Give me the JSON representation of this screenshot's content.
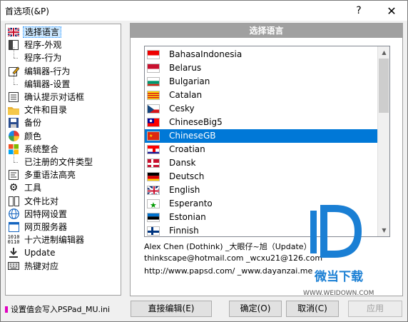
{
  "window": {
    "title": "首选项(&P)",
    "help_label": "?",
    "close_label": "✕"
  },
  "tree": [
    {
      "label": "选择语言",
      "icon": "flag-uk-icon",
      "selected": true
    },
    {
      "label": "程序-外观",
      "icon": "window-layout-icon"
    },
    {
      "label": "程序-行为",
      "sub": true
    },
    {
      "label": "编辑器-行为",
      "icon": "edit-icon"
    },
    {
      "label": "编辑器-设置",
      "sub": true
    },
    {
      "label": "确认提示对话框",
      "icon": "checklist-icon"
    },
    {
      "label": "文件和目录",
      "icon": "folder-icon"
    },
    {
      "label": "备份",
      "icon": "floppy-icon"
    },
    {
      "label": "颜色",
      "icon": "color-wheel-icon"
    },
    {
      "label": "系统整合",
      "icon": "windows-logo-icon"
    },
    {
      "label": "已注册的文件类型",
      "sub": true
    },
    {
      "label": "多重语法高亮",
      "icon": "highlight-icon"
    },
    {
      "label": "工具",
      "icon": "gear-icon"
    },
    {
      "label": "文件比对",
      "icon": "compare-icon"
    },
    {
      "label": "因特网设置",
      "icon": "globe-icon"
    },
    {
      "label": "网页服务器",
      "icon": "server-icon"
    },
    {
      "label": "十六进制编辑器",
      "icon": "binary-icon"
    },
    {
      "label": "Update",
      "icon": "download-icon"
    },
    {
      "label": "热键对应",
      "icon": "keyboard-icon"
    }
  ],
  "panel": {
    "header": "选择语言"
  },
  "languages": [
    {
      "name": "BahasaIndonesia",
      "flag": [
        "#e00",
        "#fff"
      ]
    },
    {
      "name": "Belarus",
      "flag": [
        "#c8102e",
        "#fff"
      ]
    },
    {
      "name": "Bulgarian",
      "flag": [
        "#fff",
        "#00966e",
        "#d62612"
      ]
    },
    {
      "name": "Catalan",
      "flag": [
        "#fcdd09",
        "#da121a"
      ]
    },
    {
      "name": "Cesky",
      "flag": [
        "#fff",
        "#d7141a",
        "#11457e"
      ]
    },
    {
      "name": "ChineseBig5",
      "flag": [
        "#fe0000",
        "#000095"
      ]
    },
    {
      "name": "ChineseGB",
      "flag": [
        "#de2910",
        "#ffde00"
      ],
      "selected": true
    },
    {
      "name": "Croatian",
      "flag": [
        "#ff0000",
        "#fff",
        "#171796"
      ]
    },
    {
      "name": "Dansk",
      "flag": [
        "#c8102e",
        "#fff"
      ]
    },
    {
      "name": "Deutsch",
      "flag": [
        "#000",
        "#dd0000",
        "#ffce00"
      ]
    },
    {
      "name": "English",
      "flag": [
        "#012169",
        "#c8102e",
        "#fff"
      ]
    },
    {
      "name": "Esperanto",
      "flag": [
        "#fff",
        "#009900"
      ]
    },
    {
      "name": "Estonian",
      "flag": [
        "#0072ce",
        "#000",
        "#fff"
      ]
    },
    {
      "name": "Finnish",
      "flag": [
        "#fff",
        "#003580"
      ]
    }
  ],
  "info": {
    "line1": "Alex Chen (Dothink) _大眼仔~旭（Update）",
    "line2": "thinkscape@hotmail.com _wcxu21@126.com",
    "line3": "http://www.papsd.com/ _www.dayanzai.me"
  },
  "footer": {
    "note": "设置值会写入PSPad_MU.ini",
    "edit_direct": "直接编辑(E)",
    "ok": "确定(O)",
    "cancel": "取消(C)",
    "apply": "应用"
  },
  "watermark": {
    "title": "微当下载",
    "url": "WWW.WEIDOWN.COM",
    "color": "#1a7fd4"
  }
}
